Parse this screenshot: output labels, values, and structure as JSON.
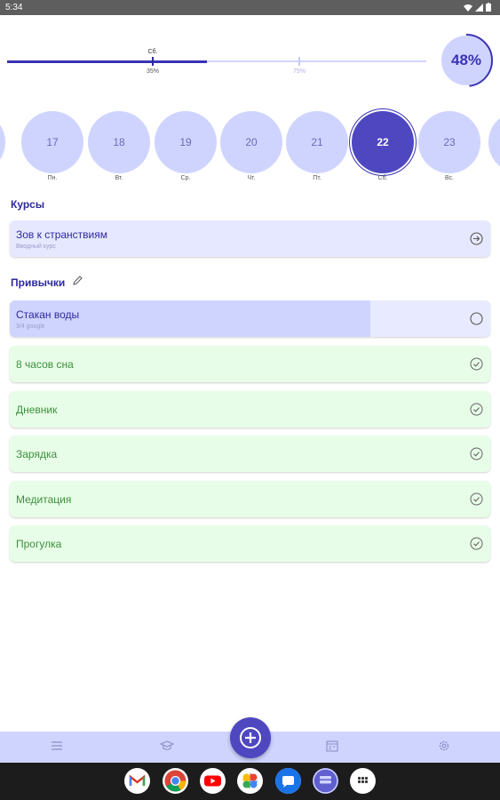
{
  "status_bar": {
    "time": "5:34"
  },
  "progress": {
    "marker_label": "Сб.",
    "marker1_percent": "35%",
    "marker2_percent": "75%",
    "day_progress_percent": "48%",
    "day_progress_value": 0.48,
    "track_fill_value": 0.48
  },
  "days": [
    {
      "num": "17",
      "weekday": "Пн."
    },
    {
      "num": "18",
      "weekday": "Вт."
    },
    {
      "num": "19",
      "weekday": "Ср."
    },
    {
      "num": "20",
      "weekday": "Чт."
    },
    {
      "num": "21",
      "weekday": "Пт."
    },
    {
      "num": "22",
      "weekday": "Сб.",
      "selected": true
    },
    {
      "num": "23",
      "weekday": "Вс."
    }
  ],
  "courses": {
    "title": "Курсы",
    "item": {
      "title": "Зов к странствиям",
      "subtitle": "Вводный курс"
    }
  },
  "habits": {
    "title": "Привычки",
    "items": [
      {
        "name": "Стакан воды",
        "progress_text": "3/4 google",
        "progress_value": 0.75,
        "done": false
      },
      {
        "name": "8 часов сна",
        "done": true
      },
      {
        "name": "Дневник",
        "done": true
      },
      {
        "name": "Зарядка",
        "done": true
      },
      {
        "name": "Медитация",
        "done": true
      },
      {
        "name": "Прогулка",
        "done": true
      }
    ]
  },
  "colors": {
    "accent": "#4e47c0",
    "light_accent": "#cfd4ff",
    "done_bg": "#e7fde7",
    "done_text": "#3d8f3d"
  },
  "icons": {
    "nav": [
      "list-icon",
      "graduation-cap-icon",
      "add-icon",
      "calendar-icon",
      "settings-icon"
    ],
    "dock": [
      "gmail-icon",
      "chrome-icon",
      "youtube-icon",
      "photos-icon",
      "messages-icon",
      "app-icon",
      "app-drawer-icon"
    ]
  }
}
